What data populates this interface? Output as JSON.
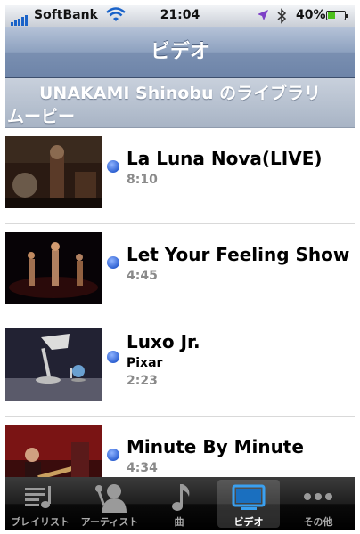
{
  "status_bar": {
    "carrier": "SoftBank",
    "time": "21:04",
    "battery_percent": "40%",
    "battery_level": 0.4,
    "icons": [
      "signal-icon",
      "wifi-icon",
      "location-icon",
      "bluetooth-icon",
      "battery-icon"
    ]
  },
  "nav": {
    "title": "ビデオ"
  },
  "library": {
    "owner_line": "UNAKAMI Shinobu のライブラリ",
    "section_line": "ムービー"
  },
  "videos": [
    {
      "title": "La Luna Nova(LIVE)",
      "subtitle": "",
      "duration": "8:10"
    },
    {
      "title": "Let Your Feeling Show",
      "subtitle": "",
      "duration": "4:45"
    },
    {
      "title": "Luxo Jr.",
      "subtitle": "Pixar",
      "duration": "2:23"
    },
    {
      "title": "Minute By Minute",
      "subtitle": "",
      "duration": "4:34"
    }
  ],
  "tabs": [
    {
      "label": "プレイリスト",
      "icon": "playlist-icon",
      "active": false
    },
    {
      "label": "アーティスト",
      "icon": "artist-icon",
      "active": false
    },
    {
      "label": "曲",
      "icon": "song-icon",
      "active": false
    },
    {
      "label": "ビデオ",
      "icon": "video-icon",
      "active": true
    },
    {
      "label": "その他",
      "icon": "more-icon",
      "active": false
    }
  ],
  "colors": {
    "navbar": "#8da1bf",
    "unwatched_dot": "#2f62d3",
    "tabbar": "#000000",
    "location_arrow": "#7d3fc7",
    "battery_fill": "#4cc01b"
  }
}
